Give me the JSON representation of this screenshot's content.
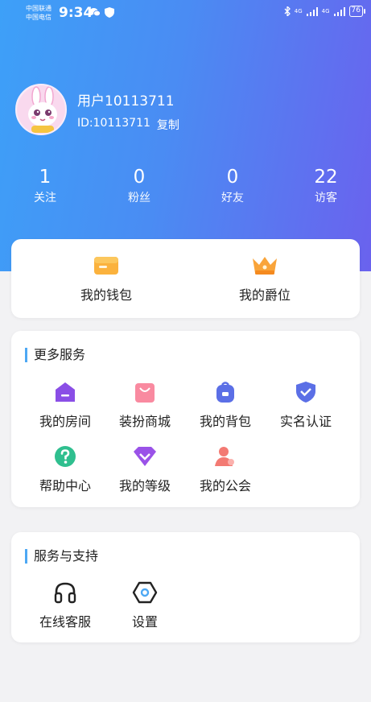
{
  "status_bar": {
    "carrier1": "中国联通",
    "carrier2": "中国电信",
    "time": "9:34",
    "net1": "4G",
    "net2": "4G",
    "battery": "76"
  },
  "profile": {
    "username": "用户10113711",
    "id_text": "ID:10113711",
    "copy_label": "复制"
  },
  "stats": [
    {
      "value": "1",
      "label": "关注"
    },
    {
      "value": "0",
      "label": "粉丝"
    },
    {
      "value": "0",
      "label": "好友"
    },
    {
      "value": "22",
      "label": "访客"
    }
  ],
  "wallet_card": {
    "items": [
      {
        "label": "我的钱包",
        "icon": "wallet-icon"
      },
      {
        "label": "我的爵位",
        "icon": "crown-icon"
      }
    ]
  },
  "more_services": {
    "title": "更多服务",
    "items": [
      {
        "label": "我的房间",
        "icon": "room-icon"
      },
      {
        "label": "装扮商城",
        "icon": "shopping-bag-icon"
      },
      {
        "label": "我的背包",
        "icon": "backpack-icon"
      },
      {
        "label": "实名认证",
        "icon": "shield-check-icon"
      },
      {
        "label": "帮助中心",
        "icon": "help-icon"
      },
      {
        "label": "我的等级",
        "icon": "diamond-level-icon"
      },
      {
        "label": "我的公会",
        "icon": "guild-icon"
      }
    ]
  },
  "support": {
    "title": "服务与支持",
    "items": [
      {
        "label": "在线客服",
        "icon": "headset-icon"
      },
      {
        "label": "设置",
        "icon": "settings-hexagon-icon"
      }
    ]
  },
  "colors": {
    "gradient_start": "#3da0f8",
    "gradient_end": "#6a62ee",
    "accent_bar": "#4da8f4"
  }
}
